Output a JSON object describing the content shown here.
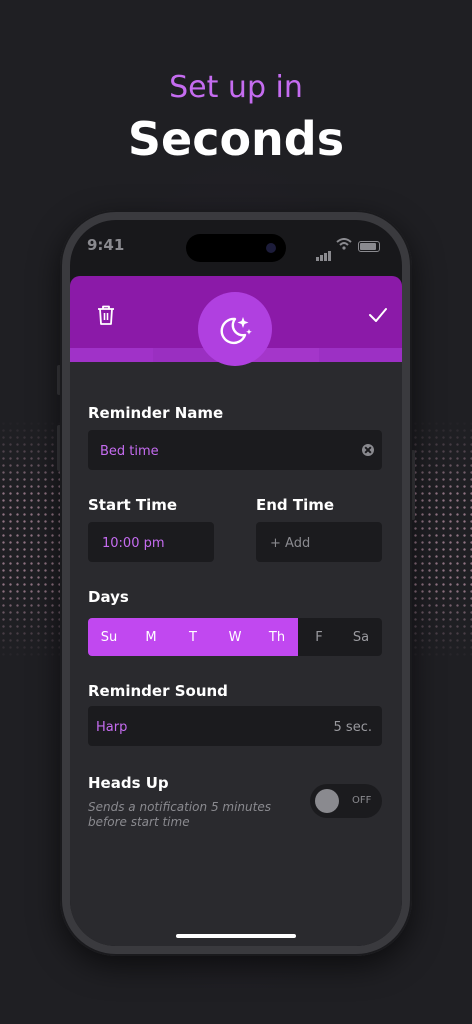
{
  "headline": {
    "small": "Set up in",
    "big": "Seconds"
  },
  "status_bar": {
    "time": "9:41"
  },
  "form": {
    "reminder_name_label": "Reminder Name",
    "reminder_name_value": "Bed time",
    "start_time_label": "Start Time",
    "start_time_value": "10:00 pm",
    "end_time_label": "End Time",
    "end_time_placeholder": "+ Add",
    "days_label": "Days",
    "days": [
      {
        "label": "Su",
        "selected": true
      },
      {
        "label": "M",
        "selected": true
      },
      {
        "label": "T",
        "selected": true
      },
      {
        "label": "W",
        "selected": true
      },
      {
        "label": "Th",
        "selected": true
      },
      {
        "label": "F",
        "selected": false
      },
      {
        "label": "Sa",
        "selected": false
      }
    ],
    "reminder_sound_label": "Reminder Sound",
    "reminder_sound_value": "Harp",
    "reminder_sound_duration": "5 sec.",
    "heads_up_label": "Heads Up",
    "heads_up_hint": "Sends a notification 5 minutes before start time",
    "heads_up_toggle": "OFF"
  },
  "icons": {
    "delete": "trash-icon",
    "confirm": "check-icon",
    "reminder_type": "moon-stars-icon"
  },
  "colors": {
    "accent": "#c148f0",
    "header": "#8b1aa8",
    "background": "#1f1f23",
    "field": "#1b1b1e"
  }
}
